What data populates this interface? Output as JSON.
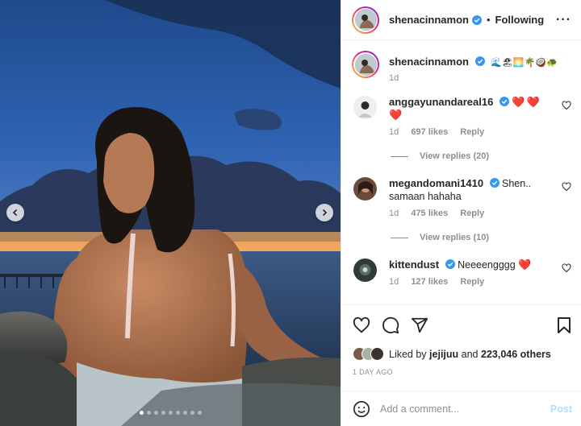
{
  "post": {
    "author": "shenacinnamon",
    "following_label": "Following",
    "separator": "•",
    "caption_emojis": "🌊🏖🌅🌴🥥🐢",
    "caption_time": "1d"
  },
  "media": {
    "slide_count": 9,
    "active_slide": 1
  },
  "comments": [
    {
      "user": "anggayunandareal16",
      "verified": true,
      "text": "",
      "hearts": "❤️❤️❤️",
      "time": "1d",
      "likes": "697 likes",
      "reply_label": "Reply",
      "replies": "View replies (20)"
    },
    {
      "user": "megandomani1410",
      "verified": true,
      "text": "Shen.. samaan hahaha",
      "hearts": "",
      "time": "1d",
      "likes": "475 likes",
      "reply_label": "Reply",
      "replies": "View replies (10)"
    },
    {
      "user": "kittendust",
      "verified": true,
      "text": "Neeeengggg",
      "hearts": "❤️",
      "time": "1d",
      "likes": "127 likes",
      "reply_label": "Reply",
      "replies": ""
    }
  ],
  "likes": {
    "prefix": "Liked by",
    "first_user": "jejijuu",
    "conjunction": "and",
    "others": "223,046 others"
  },
  "date": "1 DAY AGO",
  "add_comment": {
    "placeholder": "Add a comment...",
    "post_label": "Post"
  },
  "colors": {
    "verified": "#3897f0",
    "heart": "#ed1c24",
    "post_button": "#b2dffc"
  },
  "icons": [
    "more-options-icon",
    "verified-icon",
    "heart-icon",
    "comment-icon",
    "share-icon",
    "bookmark-icon",
    "emoji-icon",
    "chevron-left-icon",
    "chevron-right-icon"
  ]
}
